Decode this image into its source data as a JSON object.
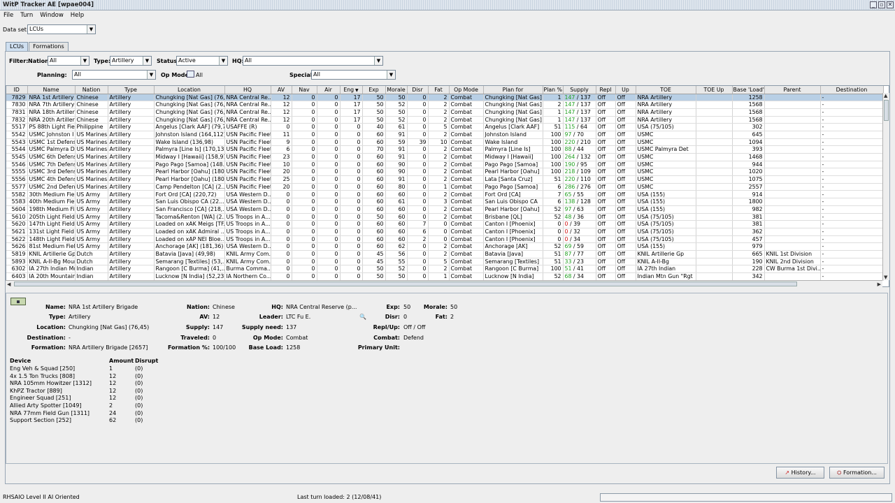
{
  "window": {
    "title": "WitP Tracker AE [wpae004]",
    "controls": [
      "_",
      "▫",
      "✕"
    ]
  },
  "menu": [
    "File",
    "Turn",
    "Window",
    "Help"
  ],
  "dataset": {
    "label": "Data set:",
    "value": "LCUs"
  },
  "tabs": [
    "LCUs",
    "Formations"
  ],
  "filters": {
    "filter_label": "Filter:",
    "nation_label": "Nation:",
    "nation": "All",
    "type_label": "Type:",
    "type": "Artillery",
    "status_label": "Status:",
    "status": "Active",
    "hq_label": "HQ:",
    "hq": "All",
    "planning_label": "Planning:",
    "planning": "All",
    "opmode_label": "Op Mode:",
    "opmode": "All",
    "special_label": "Special:",
    "special": "All"
  },
  "table": {
    "columns": [
      "ID",
      "Name",
      "Nation",
      "Type",
      "Location",
      "HQ",
      "AV",
      "Nav",
      "Air",
      "Eng",
      "Exp",
      "Morale",
      "Disr",
      "Fat",
      "Op Mode",
      "Plan for",
      "Plan %",
      "Supply",
      "Repl",
      "Up",
      "TOE",
      "TOE Up",
      "Base 'Load'",
      "Parent",
      "Destination"
    ],
    "rows": [
      [
        "7829",
        "NRA 1st Artillery Brigade",
        "Chinese",
        "Artillery",
        "Chungking [Nat Gas] (76,...",
        "NRA Central Re...",
        "12",
        "0",
        "0",
        "17",
        "50",
        "50",
        "0",
        "2",
        "Combat",
        "Chungking [Nat Gas]",
        "1",
        "147",
        "137",
        "Off",
        "Off",
        "NRA Artillery",
        "",
        "1258",
        "",
        "-"
      ],
      [
        "7830",
        "NRA 7th Artillery Brigade",
        "Chinese",
        "Artillery",
        "Chungking [Nat Gas] (76,...",
        "NRA Central Re...",
        "12",
        "0",
        "0",
        "17",
        "50",
        "52",
        "0",
        "2",
        "Combat",
        "Chungking [Nat Gas]",
        "2",
        "147",
        "137",
        "Off",
        "Off",
        "NRA Artillery",
        "",
        "1568",
        "",
        "-"
      ],
      [
        "7831",
        "NRA 18th Artillery Briga...",
        "Chinese",
        "Artillery",
        "Chungking [Nat Gas] (76,...",
        "NRA Central Re...",
        "12",
        "0",
        "0",
        "17",
        "50",
        "50",
        "0",
        "2",
        "Combat",
        "Chungking [Nat Gas]",
        "1",
        "147",
        "137",
        "Off",
        "Off",
        "NRA Artillery",
        "",
        "1568",
        "",
        "-"
      ],
      [
        "7832",
        "NRA 20th Artillery Briga...",
        "Chinese",
        "Artillery",
        "Chungking [Nat Gas] (76,...",
        "NRA Central Re...",
        "12",
        "0",
        "0",
        "17",
        "50",
        "52",
        "0",
        "2",
        "Combat",
        "Chungking [Nat Gas]",
        "1",
        "147",
        "137",
        "Off",
        "Off",
        "NRA Artillery",
        "",
        "1568",
        "",
        "-"
      ],
      [
        "5517",
        "PS 88th Light Field Artil...",
        "Philippine",
        "Artillery",
        "Angelus [Clark AAF] (79,7...",
        "USAFFE (R)",
        "0",
        "0",
        "0",
        "0",
        "40",
        "61",
        "0",
        "5",
        "Combat",
        "Angelus [Clark AAF]",
        "51",
        "115",
        "64",
        "Off",
        "Off",
        "USA (75/105)",
        "",
        "302",
        "",
        "-"
      ],
      [
        "5542",
        "USMC Johnston I Defe...",
        "US Marines",
        "Artillery",
        "Johnston Island (164,112)",
        "USN Pacific Fleet",
        "11",
        "0",
        "0",
        "0",
        "60",
        "91",
        "0",
        "2",
        "Combat",
        "Johnston Island",
        "100",
        "97",
        "70",
        "Off",
        "Off",
        "USMC",
        "",
        "645",
        "",
        "-"
      ],
      [
        "5543",
        "USMC 1st Defense Bat...",
        "US Marines",
        "Artillery",
        "Wake Island (136,98)",
        "USN Pacific Fleet",
        "9",
        "0",
        "0",
        "0",
        "60",
        "59",
        "39",
        "10",
        "Combat",
        "Wake Island",
        "100",
        "220",
        "210",
        "Off",
        "Off",
        "USMC",
        "",
        "1094",
        "",
        "-"
      ],
      [
        "5544",
        "USMC Palmyra Def Def...",
        "US Marines",
        "Artillery",
        "Palmyra [Line Is] (170,133)",
        "USN Pacific Fleet",
        "6",
        "0",
        "0",
        "0",
        "70",
        "91",
        "0",
        "2",
        "Combat",
        "Palmyra [Line Is]",
        "100",
        "88",
        "44",
        "Off",
        "Off",
        "USMC Palmyra Det",
        "",
        "393",
        "",
        "-"
      ],
      [
        "5545",
        "USMC 6th Defense Bat...",
        "US Marines",
        "Artillery",
        "Midway I [Hawaii] (158,91)",
        "USN Pacific Fleet",
        "23",
        "0",
        "0",
        "0",
        "60",
        "91",
        "0",
        "2",
        "Combat",
        "Midway I [Hawaii]",
        "100",
        "264",
        "132",
        "Off",
        "Off",
        "USMC",
        "",
        "1468",
        "",
        "-"
      ],
      [
        "5546",
        "USMC 7th Defense Bat...",
        "US Marines",
        "Artillery",
        "Pago Pago [Samoa] (148...",
        "USN Pacific Fleet",
        "10",
        "0",
        "0",
        "0",
        "60",
        "90",
        "0",
        "2",
        "Combat",
        "Pago Pago [Samoa]",
        "100",
        "190",
        "95",
        "Off",
        "Off",
        "USMC",
        "",
        "944",
        "",
        "-"
      ],
      [
        "5555",
        "USMC 3rd Defense Bat...",
        "US Marines",
        "Artillery",
        "Pearl Harbor [Oahu] (180...",
        "USN Pacific Fleet",
        "20",
        "0",
        "0",
        "0",
        "60",
        "90",
        "0",
        "2",
        "Combat",
        "Pearl Harbor [Oahu]",
        "100",
        "218",
        "109",
        "Off",
        "Off",
        "USMC",
        "",
        "1020",
        "",
        "-"
      ],
      [
        "5556",
        "USMC 4th Defense Bat...",
        "US Marines",
        "Artillery",
        "Pearl Harbor [Oahu] (180...",
        "USN Pacific Fleet",
        "25",
        "0",
        "0",
        "0",
        "60",
        "91",
        "0",
        "2",
        "Combat",
        "Lata [Santa Cruz]",
        "51",
        "220",
        "110",
        "Off",
        "Off",
        "USMC",
        "",
        "1075",
        "",
        "-"
      ],
      [
        "5577",
        "USMC 2nd Defense Ba...",
        "US Marines",
        "Artillery",
        "Camp Pendelton [CA] (2...",
        "USN Pacific Fleet",
        "20",
        "0",
        "0",
        "0",
        "60",
        "80",
        "0",
        "1",
        "Combat",
        "Pago Pago [Samoa]",
        "6",
        "286",
        "276",
        "Off",
        "Off",
        "USMC",
        "",
        "2557",
        "",
        "-"
      ],
      [
        "5582",
        "30th Medium Field Artil...",
        "US Army",
        "Artillery",
        "Fort Ord [CA] (220,72)",
        "USA Western D...",
        "0",
        "0",
        "0",
        "0",
        "60",
        "60",
        "0",
        "2",
        "Combat",
        "Fort Ord [CA]",
        "7",
        "65",
        "55",
        "Off",
        "Off",
        "USA (155)",
        "",
        "914",
        "",
        "-"
      ],
      [
        "5583",
        "40th Medium Field Artil...",
        "US Army",
        "Artillery",
        "San Luis Obispo CA (22...",
        "USA Western D...",
        "0",
        "0",
        "0",
        "0",
        "60",
        "61",
        "0",
        "3",
        "Combat",
        "San Luis Obispo CA",
        "6",
        "138",
        "128",
        "Off",
        "Off",
        "USA (155)",
        "",
        "1800",
        "",
        "-"
      ],
      [
        "5604",
        "198th Medium Field Arti...",
        "US Army",
        "Artillery",
        "San Francisco [CA] (218,...",
        "USA Western D...",
        "0",
        "0",
        "0",
        "0",
        "60",
        "60",
        "0",
        "2",
        "Combat",
        "Pearl Harbor [Oahu]",
        "52",
        "97",
        "63",
        "Off",
        "Off",
        "USA (155)",
        "",
        "982",
        "",
        "-"
      ],
      [
        "5610",
        "205th Light Field Artiller...",
        "US Army",
        "Artillery",
        "Tacoma&Renton [WA] (2...",
        "US Troops in A...",
        "0",
        "0",
        "0",
        "0",
        "50",
        "60",
        "0",
        "2",
        "Combat",
        "Brisbane [QL]",
        "52",
        "48",
        "36",
        "Off",
        "Off",
        "USA (75/105)",
        "",
        "381",
        "",
        "-"
      ],
      [
        "5620",
        "147th Light Field Artiller...",
        "US Army",
        "Artillery",
        "Loaded on xAK Meigs [TF...",
        "US Troops in A...",
        "0",
        "0",
        "0",
        "0",
        "60",
        "60",
        "7",
        "0",
        "Combat",
        "Canton I [Phoenix]",
        "0",
        "0",
        "39",
        "Off",
        "Off",
        "USA (75/105)",
        "",
        "381",
        "",
        "-"
      ],
      [
        "5621",
        "131st Light Field Artiller...",
        "US Army",
        "Artillery",
        "Loaded on xAK Admiral ...",
        "US Troops in A...",
        "0",
        "0",
        "0",
        "0",
        "60",
        "60",
        "6",
        "0",
        "Combat",
        "Canton I [Phoenix]",
        "0",
        "0",
        "32",
        "Off",
        "Off",
        "USA (75/105)",
        "",
        "362",
        "",
        "-"
      ],
      [
        "5622",
        "148th Light Field Artiller...",
        "US Army",
        "Artillery",
        "Loaded on xAP NEI Bloe...",
        "US Troops in A...",
        "0",
        "0",
        "0",
        "0",
        "60",
        "60",
        "2",
        "0",
        "Combat",
        "Canton I [Phoenix]",
        "0",
        "0",
        "34",
        "Off",
        "Off",
        "USA (75/105)",
        "",
        "457",
        "",
        "-"
      ],
      [
        "5626",
        "81st Medium Field Artil...",
        "US Army",
        "Artillery",
        "Anchorage [AK] (181,36)",
        "USA Western D...",
        "0",
        "0",
        "0",
        "0",
        "60",
        "62",
        "0",
        "2",
        "Combat",
        "Anchorage [AK]",
        "52",
        "69",
        "59",
        "Off",
        "Off",
        "USA (155)",
        "",
        "979",
        "",
        "-"
      ],
      [
        "5819",
        "KNIL Artillerie Gp",
        "Dutch",
        "Artillery",
        "Batavia [Java] (49,98)",
        "KNIL Army Com...",
        "0",
        "0",
        "0",
        "0",
        "45",
        "56",
        "0",
        "2",
        "Combat",
        "Batavia [Java]",
        "51",
        "87",
        "77",
        "Off",
        "Off",
        "KNIL Artillerie Gp",
        "",
        "665",
        "KNIL 1st Division",
        "-"
      ],
      [
        "5893",
        "KNIL A-II-Bg Mountain ...",
        "Dutch",
        "Artillery",
        "Semarang [Textiles] (53,...",
        "KNIL Army Com...",
        "0",
        "0",
        "0",
        "0",
        "45",
        "55",
        "0",
        "5",
        "Combat",
        "Semarang [Textiles]",
        "51",
        "33",
        "23",
        "Off",
        "Off",
        "KNIL A-II-Bg",
        "",
        "190",
        "KNIL 2nd Division",
        "-"
      ],
      [
        "6302",
        "IA 27th Indian Mountain...",
        "Indian",
        "Artillery",
        "Rangoon [C Burma] (41,...",
        "Burma Comma...",
        "0",
        "0",
        "0",
        "0",
        "50",
        "52",
        "0",
        "2",
        "Combat",
        "Rangoon [C Burma]",
        "100",
        "51",
        "41",
        "Off",
        "Off",
        "IA 27th Indian",
        "",
        "228",
        "CW Burma 1st Divi...",
        "-"
      ],
      [
        "6403",
        "IA 20th Mountain Gun R...",
        "Indian",
        "Artillery",
        "Lucknow [N India] (52,23)",
        "IA Northern Co...",
        "0",
        "0",
        "0",
        "0",
        "50",
        "50",
        "0",
        "1",
        "Combat",
        "Lucknow [N India]",
        "52",
        "68",
        "34",
        "Off",
        "Off",
        "Indian Mtn Gun \"Rgt",
        "",
        "342",
        "",
        "-"
      ]
    ]
  },
  "details": {
    "name_l": "Name:",
    "name": "NRA 1st Artillery Brigade",
    "type_l": "Type:",
    "type": "Artillery",
    "location_l": "Location:",
    "location": "Chungking [Nat Gas] (76,45)",
    "destination_l": "Destination:",
    "destination": "-",
    "formation_l": "Formation:",
    "formation": "NRA Artillery Brigade [2657]",
    "nation_l": "Nation:",
    "nation": "Chinese",
    "av_l": "AV:",
    "av": "12",
    "supply_l": "Supply:",
    "supply": "147",
    "traveled_l": "Traveled:",
    "traveled": "0",
    "formpct_l": "Formation %:",
    "formpct": "100/100",
    "hq_l": "HQ:",
    "hq": "NRA Central Reserve (p...",
    "leader_l": "Leader:",
    "leader": "LTC Fu E.",
    "supplyneed_l": "Supply need:",
    "supplyneed": "137",
    "opmode_l": "Op Mode:",
    "opmode": "Combat",
    "baseload_l": "Base Load:",
    "baseload": "1258",
    "exp_l": "Exp:",
    "exp": "50",
    "disr_l": "Disr:",
    "disr": "0",
    "replup_l": "Repl/Up:",
    "replup": "Off / Off",
    "combat_l": "Combat:",
    "combat": "Defend",
    "primary_l": "Primary Unit:",
    "morale_l": "Morale:",
    "morale": "50",
    "fat_l": "Fat:",
    "fat": "2",
    "dev_headers": [
      "Device",
      "Amount",
      "Disrupt"
    ],
    "devices": [
      [
        "Eng Veh & Squad [250]",
        "1",
        "(0)"
      ],
      [
        "4x 1.5 Ton Trucks [808]",
        "12",
        "(0)"
      ],
      [
        "NRA 105mm Howitzer [1312]",
        "12",
        "(0)"
      ],
      [
        "KhPZ Tractor [889]",
        "12",
        "(0)"
      ],
      [
        "Engineer Squad [251]",
        "12",
        "(0)"
      ],
      [
        "Allied Arty Spotter [1049]",
        "2",
        "(0)"
      ],
      [
        "NRA 77mm Field Gun [1311]",
        "24",
        "(0)"
      ],
      [
        "Support Section [252]",
        "62",
        "(0)"
      ]
    ]
  },
  "buttons": {
    "history": "History...",
    "formation": "Formation..."
  },
  "status": {
    "left": "RHSAIO Level II AI Oriented",
    "center": "Last turn loaded: 2 (12/08/41)"
  },
  "colors": {
    "selected_row": "#b8cfe5",
    "supply_green": "#1e9e1e",
    "supply_red": "#d01010"
  }
}
